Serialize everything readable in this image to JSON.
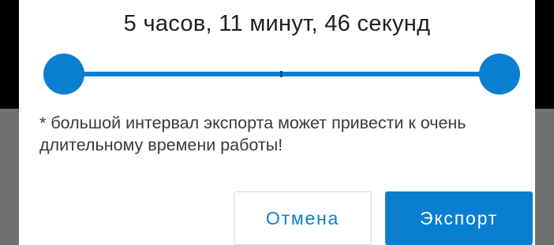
{
  "dialog": {
    "duration_text": "5 часов, 11 минут, 46 секунд",
    "range": {
      "start_fraction": 0.0,
      "end_fraction": 1.0
    },
    "note": "* большой интервал экспорта может привести к очень длительному времени работы!",
    "buttons": {
      "cancel_label": "Отмена",
      "export_label": "Экспорт"
    }
  },
  "colors": {
    "accent": "#0a7fd0",
    "text": "#202020",
    "note_text": "#3a3a3a",
    "backdrop_dark": "#000000",
    "backdrop_dim": "#707070"
  }
}
